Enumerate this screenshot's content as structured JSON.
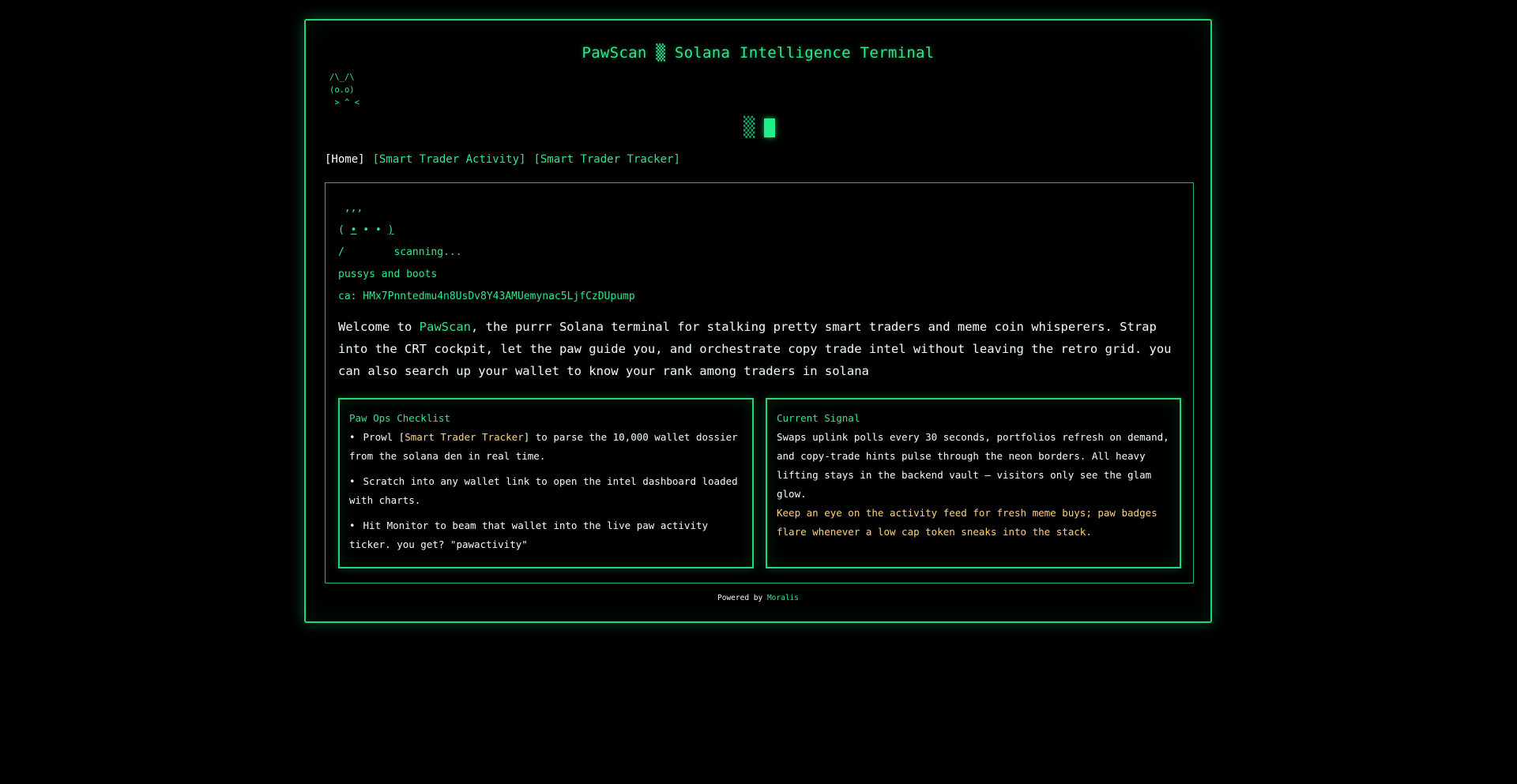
{
  "header": {
    "title": "PawScan ▒ Solana Intelligence Terminal",
    "logo_ascii": "/\\_/\\\n(o.o)\n > ^ <",
    "loader_glyph": "▒"
  },
  "nav": {
    "items": [
      {
        "label": "[Home]",
        "active": true
      },
      {
        "label": "[Smart Trader Activity]",
        "active": false
      },
      {
        "label": "[Smart Trader Tracker]",
        "active": false
      }
    ]
  },
  "main": {
    "cat_whiskers": " ,,,",
    "cat_face_open": "( ",
    "cat_eye_left": "•",
    "cat_face_mid": " • • ",
    "cat_eye_right": ")",
    "cat_body": "/",
    "status": "scanning...",
    "tagline": "pussys and boots",
    "contract": "ca: HMx7Pnntedmu4n8UsDv8Y43AMUemynac5LjfCzDUpump",
    "welcome_prefix": "Welcome to ",
    "welcome_brand": "PawScan",
    "welcome_rest": ", the purrr Solana terminal for stalking pretty smart traders and meme coin whisperers. Strap into the CRT cockpit, let the paw guide you, and orchestrate copy trade intel without leaving the retro grid. you can also search up your wallet to know your rank among traders in solana"
  },
  "checklist": {
    "title": "Paw Ops Checklist",
    "item1_prefix": "Prowl [",
    "item1_link": "Smart Trader Tracker",
    "item1_suffix": "] to parse the 10,000 wallet dossier from the solana den in real time.",
    "item2": "Scratch into any wallet link to open the intel dashboard loaded with charts.",
    "item3": "Hit Monitor to beam that wallet into the live paw activity ticker. you get? \"pawactivity\""
  },
  "signal": {
    "title": "Current Signal",
    "body": "Swaps uplink polls every 30 seconds, portfolios refresh on demand, and copy-trade hints pulse through the neon borders. All heavy lifting stays in the backend vault — visitors only see the glam glow.",
    "alert": "Keep an eye on the activity feed for fresh meme buys; paw badges flare whenever a low cap token sneaks into the stack."
  },
  "footer": {
    "prefix": "Powered by ",
    "brand": "Moralis"
  },
  "colors": {
    "accent": "#2ee88c",
    "border": "#1fd67a",
    "highlight": "#ffd27a",
    "background": "#000000"
  }
}
